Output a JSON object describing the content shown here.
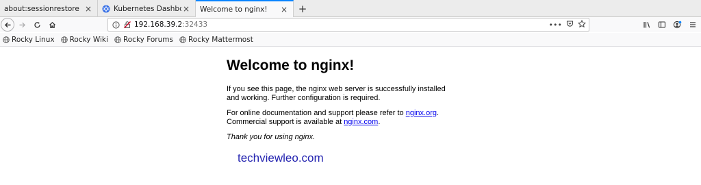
{
  "tabs": [
    {
      "label": "about:sessionrestore",
      "active": false,
      "icon": "none"
    },
    {
      "label": "Kubernetes Dashboard",
      "active": false,
      "icon": "kubernetes-icon"
    },
    {
      "label": "Welcome to nginx!",
      "active": true,
      "icon": "none"
    }
  ],
  "tab_close_glyph": "×",
  "new_tab_glyph": "+",
  "nav": {
    "url_host": "192.168.39.2",
    "url_port": ":32433",
    "overflow_glyph": "•••"
  },
  "bookmarks": [
    {
      "label": "Rocky Linux"
    },
    {
      "label": "Rocky Wiki"
    },
    {
      "label": "Rocky Forums"
    },
    {
      "label": "Rocky Mattermost"
    }
  ],
  "page": {
    "title": "Welcome to nginx!",
    "para1": "If you see this page, the nginx web server is successfully installed and working. Further configuration is required.",
    "para2_a": "For online documentation and support please refer to ",
    "para2_link1": "nginx.org",
    "para2_b": ".",
    "para2_c": "Commercial support is available at ",
    "para2_link2": "nginx.com",
    "para2_d": ".",
    "para3": "Thank you for using nginx."
  },
  "watermark": "techviewleo.com",
  "colors": {
    "accent": "#0a84ff",
    "link": "#0000ee",
    "watermark": "#2323b0"
  }
}
